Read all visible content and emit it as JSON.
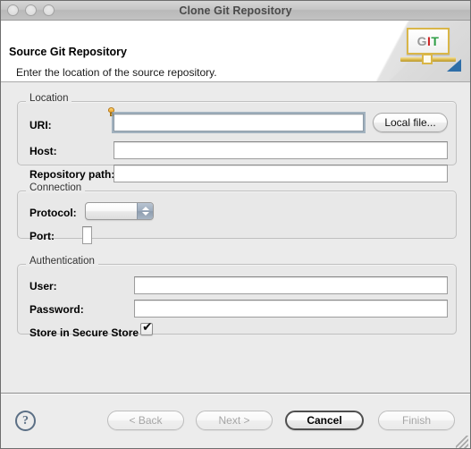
{
  "window": {
    "title": "Clone Git Repository",
    "traffic_lights": [
      "close",
      "minimize",
      "zoom"
    ]
  },
  "header": {
    "title": "Source Git Repository",
    "subtitle": "Enter the location of the source repository.",
    "logo": {
      "g": "G",
      "i": "I",
      "t": "T"
    }
  },
  "location": {
    "group_title": "Location",
    "uri_label": "URI:",
    "uri_value": "",
    "uri_placeholder": "",
    "local_file_button": "Local file...",
    "host_label": "Host:",
    "host_value": "",
    "repo_path_label": "Repository path:",
    "repo_path_value": ""
  },
  "connection": {
    "group_title": "Connection",
    "protocol_label": "Protocol:",
    "protocol_value": "",
    "protocol_options": [],
    "port_label": "Port:",
    "port_value": ""
  },
  "authentication": {
    "group_title": "Authentication",
    "user_label": "User:",
    "user_value": "",
    "password_label": "Password:",
    "password_value": "",
    "store_secure_label": "Store in Secure Store",
    "store_secure_checked": true,
    "checkmark": "✔"
  },
  "buttons": {
    "help": "?",
    "back": "< Back",
    "next": "Next >",
    "cancel": "Cancel",
    "finish": "Finish"
  },
  "colors": {
    "window_bg": "#ebebeb",
    "header_bg": "#ffffff",
    "group_bg": "#e8e8e8",
    "accent_focus": "#8ba0b1",
    "git_red": "#cc2222",
    "git_green": "#2e9e45",
    "git_gray": "#9a9a9a",
    "git_gold": "#d9b648",
    "help_blue": "#5b6f85"
  }
}
